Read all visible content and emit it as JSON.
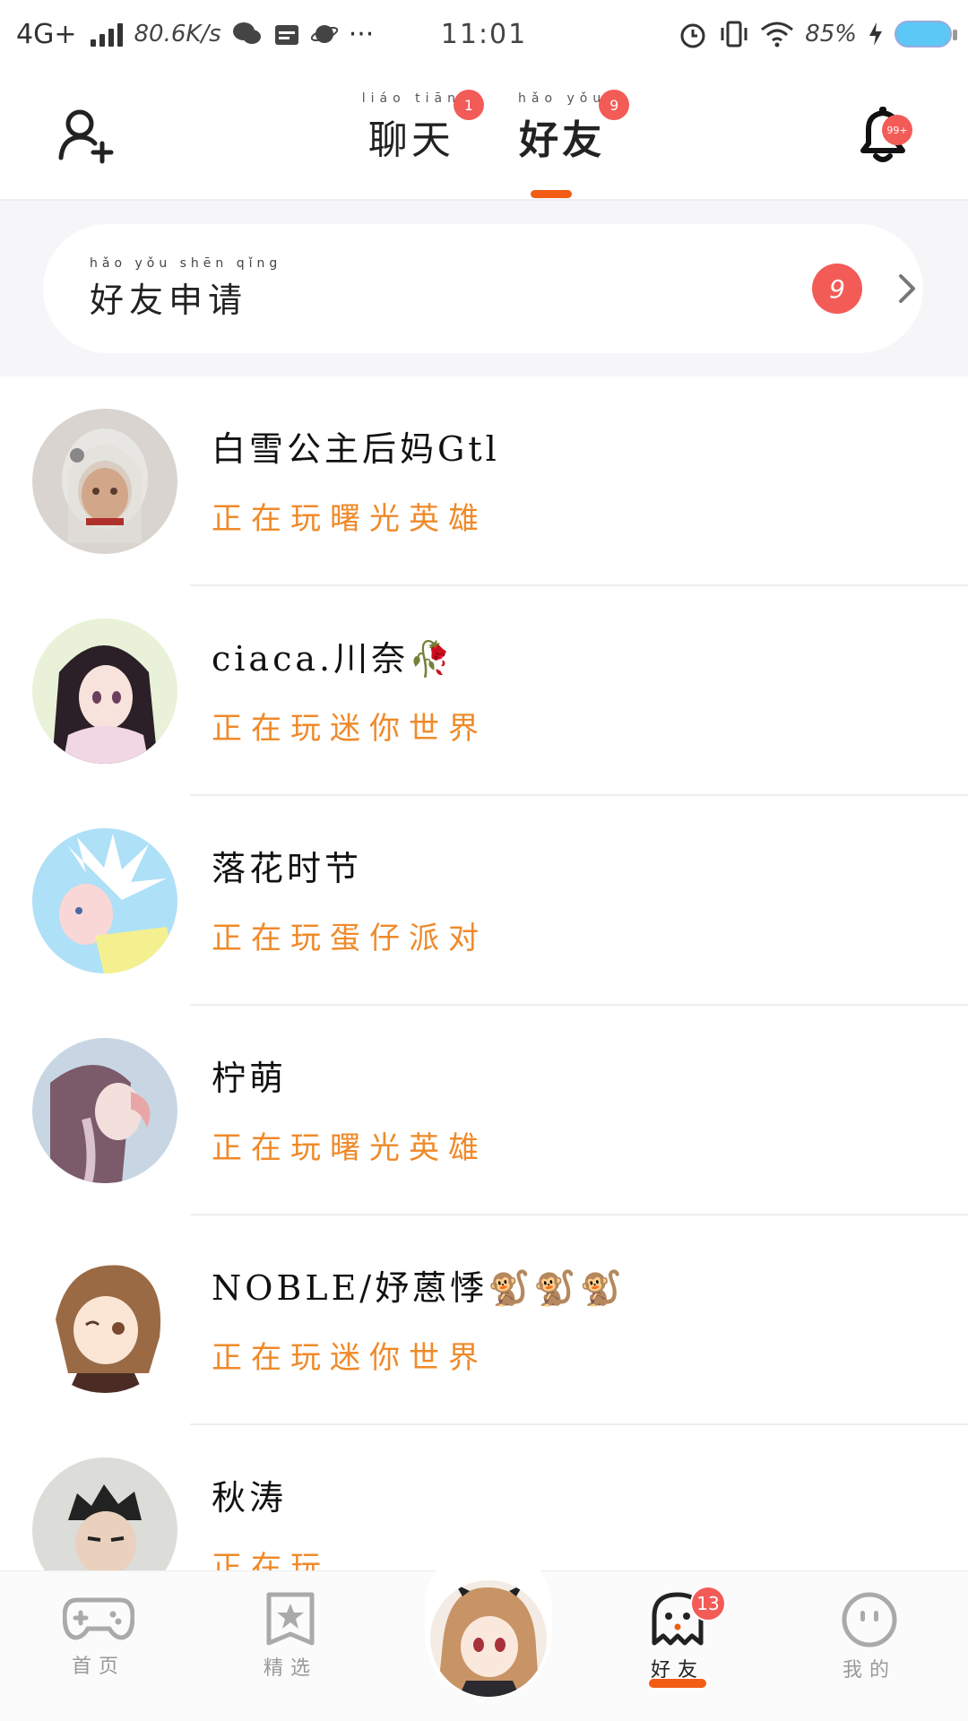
{
  "status_bar": {
    "network": "4G+",
    "speed": "80.6K/s",
    "time": "11:01",
    "battery": "85%"
  },
  "header": {
    "tabs": [
      {
        "pinyin": "liáo tiān",
        "label": "聊天",
        "badge": "1",
        "active": false
      },
      {
        "pinyin": "hǎo yǒu",
        "label": "好友",
        "badge": "9",
        "active": true
      }
    ],
    "bell_badge": "99+"
  },
  "requests": {
    "pinyin": "hǎo yǒu shēn qǐng",
    "label": "好友申请",
    "count": "9"
  },
  "friends": [
    {
      "name": "白雪公主后妈Gtl",
      "status": "正在玩曙光英雄",
      "avatar_colors": [
        "#d9d4cf",
        "#cfc9c2"
      ]
    },
    {
      "name": "ciaca.川奈🥀",
      "status": "正在玩迷你世界",
      "avatar_colors": [
        "#e9f2d8",
        "#f1d6e3"
      ]
    },
    {
      "name": "落花时节",
      "status": "正在玩蛋仔派对",
      "avatar_colors": [
        "#aee0f7",
        "#f5f08f"
      ]
    },
    {
      "name": "柠萌",
      "status": "正在玩曙光英雄",
      "avatar_colors": [
        "#c7d6e2",
        "#c9b7c8"
      ]
    },
    {
      "name": "NOBLE/妤蒽悸🐒🐒🐒",
      "status": "正在玩迷你世界",
      "avatar_colors": [
        "#ffffff",
        "#b98a63"
      ]
    },
    {
      "name": "秋涛",
      "status": "正在玩",
      "avatar_colors": [
        "#dcdcd8",
        "#cfcfca"
      ]
    }
  ],
  "bottom_nav": {
    "items": [
      {
        "label": "首页",
        "icon": "gamepad-icon",
        "active": false
      },
      {
        "label": "精选",
        "icon": "star-card-icon",
        "active": false
      },
      {
        "label": "好友",
        "icon": "ghost-icon",
        "active": true,
        "badge": "13"
      },
      {
        "label": "我的",
        "icon": "face-icon",
        "active": false
      }
    ]
  },
  "colors": {
    "accent": "#f25c14",
    "badge": "#f35b57",
    "status_text": "#ef8a2a"
  }
}
